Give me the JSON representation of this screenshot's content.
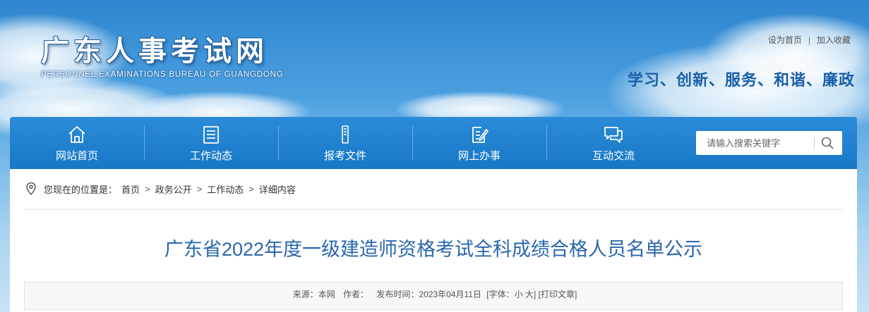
{
  "header": {
    "logo_cn": "广东人事考试网",
    "logo_en": "PERSONNEL EXAMINATIONS BUREAU OF GUANGDONG",
    "top_links": {
      "set_home": "设为首页",
      "separator": "|",
      "add_favorite": "加入收藏"
    },
    "slogan": "学习、创新、服务、和谐、廉政"
  },
  "nav": {
    "items": [
      {
        "label": "网站首页",
        "icon": "home-icon"
      },
      {
        "label": "工作动态",
        "icon": "news-icon"
      },
      {
        "label": "报考文件",
        "icon": "document-icon"
      },
      {
        "label": "网上办事",
        "icon": "edit-form-icon"
      },
      {
        "label": "互动交流",
        "icon": "chat-icon"
      }
    ],
    "search": {
      "placeholder": "请输入搜索关键字",
      "icon": "search-icon"
    }
  },
  "breadcrumb": {
    "prefix": "您现在的位置是：",
    "items": [
      "首页",
      "政务公开",
      "工作动态",
      "详细内容"
    ],
    "separator": ">",
    "icon": "location-pin-icon"
  },
  "article": {
    "title": "广东省2022年度一级建造师资格考试全科成绩合格人员名单公示",
    "meta": {
      "source": "来源：本网",
      "author": "作者：",
      "published": "发布时间：2023年04月11日",
      "font_size": "[字体：小 大]",
      "print": "[打印文章]"
    }
  },
  "colors": {
    "nav_bg": "#1878c7",
    "title": "#2a66ad",
    "slogan": "#1a5fa8"
  }
}
